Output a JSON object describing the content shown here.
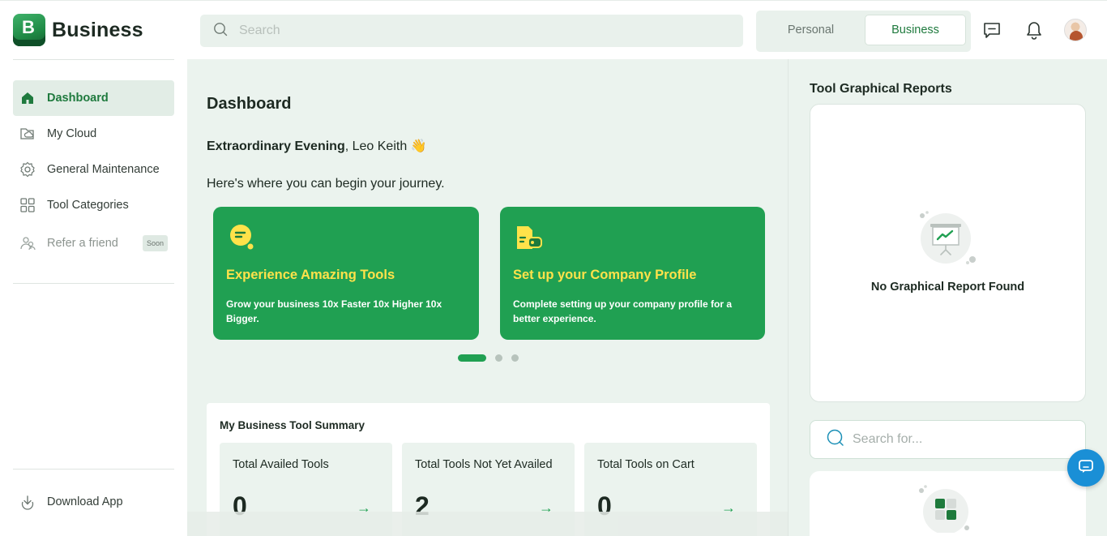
{
  "brand": {
    "logo_letter": "B",
    "name": "Business"
  },
  "sidebar": {
    "items": [
      {
        "label": "Dashboard",
        "icon": "home-icon",
        "active": true
      },
      {
        "label": "My Cloud",
        "icon": "cloud-folder-icon"
      },
      {
        "label": "General Maintenance",
        "icon": "gear-icon"
      },
      {
        "label": "Tool Categories",
        "icon": "grid-icon"
      },
      {
        "label": "Refer a friend",
        "icon": "users-icon",
        "badge": "Soon",
        "disabled": true
      }
    ],
    "download_label": "Download App"
  },
  "topbar": {
    "search_placeholder": "Search",
    "toggle": {
      "personal": "Personal",
      "business": "Business",
      "selected": "Business"
    }
  },
  "main": {
    "title": "Dashboard",
    "greeting_bold": "Extraordinary Evening",
    "greeting_rest": ", Leo Keith",
    "greeting_emoji": "👋",
    "subtitle": "Here's where you can begin your journey.",
    "cards": [
      {
        "title": "Experience Amazing Tools",
        "desc": "Grow your business 10x Faster 10x Higher 10x Bigger."
      },
      {
        "title": "Set up your Company Profile",
        "desc": "Complete setting up your company profile for a better experience."
      }
    ],
    "carousel": {
      "count": 3,
      "active": 0
    },
    "summary": {
      "title": "My Business Tool Summary",
      "stats": [
        {
          "label": "Total Availed Tools",
          "value": "0",
          "arrow": "→"
        },
        {
          "label": "Total Tools Not Yet Availed",
          "value": "2",
          "arrow": "→"
        },
        {
          "label": "Total Tools on Cart",
          "value": "0",
          "arrow": "→"
        }
      ]
    }
  },
  "right": {
    "title": "Tool Graphical Reports",
    "empty_text": "No Graphical Report Found",
    "search_placeholder": "Search for..."
  },
  "colors": {
    "accent": "#20a052",
    "card_title": "#ffe24a",
    "background": "#ebf3ee",
    "chat_fab": "#1a8fd6"
  }
}
